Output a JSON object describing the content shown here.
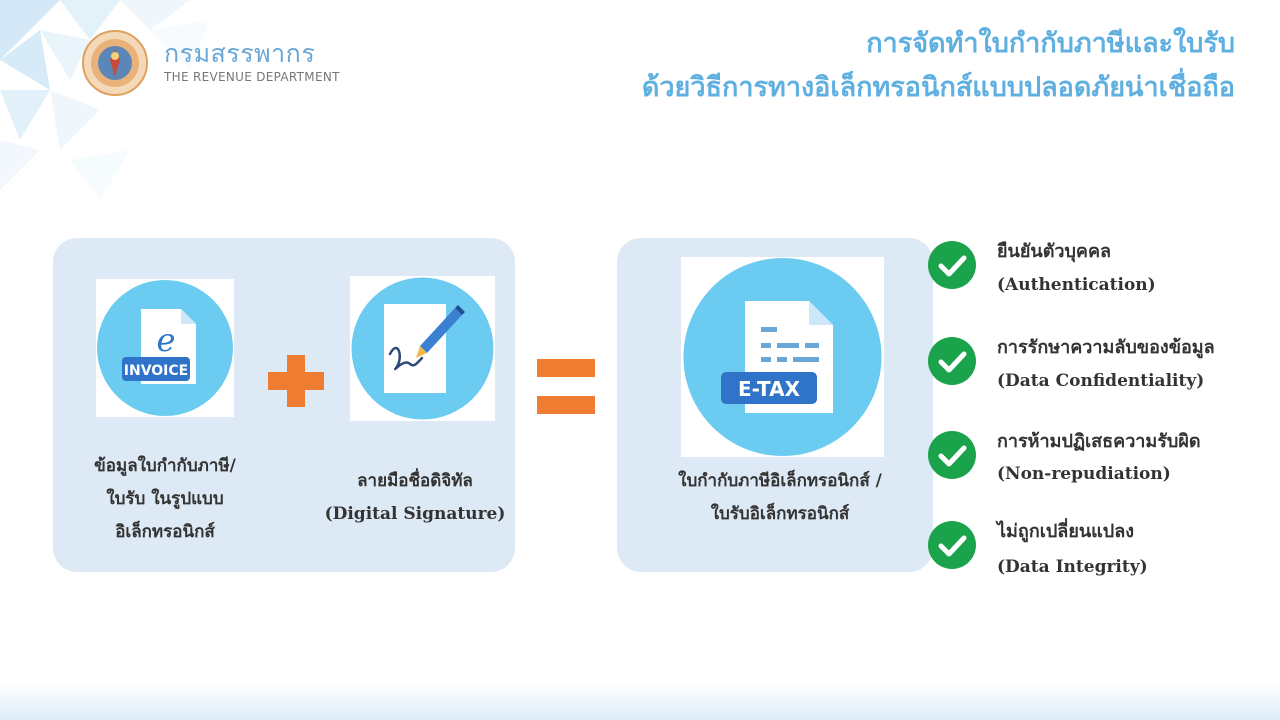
{
  "header": {
    "logo_th": "กรมสรรพากร",
    "logo_en": "THE REVENUE DEPARTMENT",
    "title_line1": "การจัดทำใบกำกับภาษีและใบรับ",
    "title_line2": "ด้วยวิธีการทางอิเล็กทรอนิกส์แบบปลอดภัยน่าเชื่อถือ"
  },
  "equation": {
    "invoice": {
      "icon_letter": "e",
      "icon_badge": "INVOICE",
      "label_lines": [
        "ข้อมูลใบกำกับภาษี/",
        "ใบรับ ในรูปแบบ",
        "อิเล็กทรอนิกส์"
      ]
    },
    "signature": {
      "label_lines": [
        "ลายมือชื่อดิจิทัล",
        "(Digital Signature)"
      ]
    },
    "result": {
      "icon_badge": "E-TAX",
      "label_lines": [
        "ใบกำกับภาษีอิเล็กทรอนิกส์ /",
        "ใบรับอิเล็กทรอนิกส์"
      ]
    }
  },
  "features": [
    {
      "th": "ยืนยันตัวบุคคล",
      "en": "(Authentication)"
    },
    {
      "th": "การรักษาความลับของข้อมูล",
      "en": "(Data Confidentiality)"
    },
    {
      "th": "การห้ามปฏิเสธความรับผิด",
      "en": "(Non-repudiation)"
    },
    {
      "th": "ไม่ถูกเปลี่ยนแปลง",
      "en": "(Data Integrity)"
    }
  ],
  "colors": {
    "accent_blue": "#5fb0e0",
    "circle_blue": "#6ccbf0",
    "panel_bg": "#dde9f4",
    "operator_orange": "#ef7d31",
    "check_green": "#1aa34a",
    "badge_blue": "#2f74c9"
  }
}
